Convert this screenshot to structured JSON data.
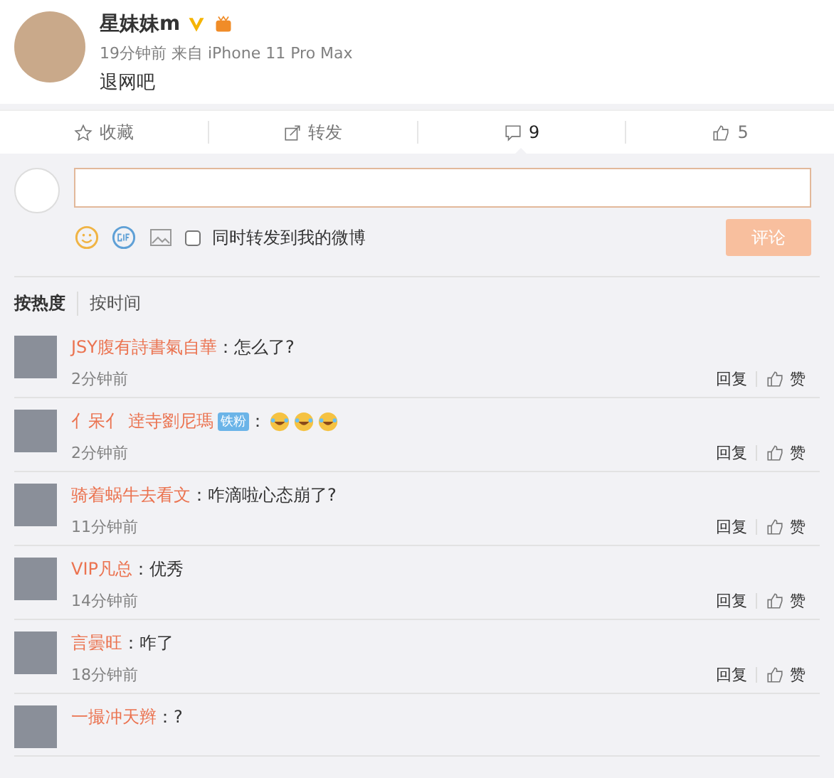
{
  "post": {
    "author": "星妹妹m",
    "verified": true,
    "meta": "19分钟前 来自 iPhone 11 Pro Max",
    "text": "退网吧"
  },
  "actions": [
    {
      "kind": "favorite",
      "label": "收藏",
      "selected": false
    },
    {
      "kind": "repost",
      "label": "转发",
      "selected": false
    },
    {
      "kind": "comment",
      "label": "9",
      "selected": true
    },
    {
      "kind": "like",
      "label": "5",
      "selected": false
    }
  ],
  "composer": {
    "repost_label": "同时转发到我的微博",
    "repost_checked": false,
    "submit": "评论",
    "submit_disabled": true
  },
  "sort_tabs": [
    {
      "label": "按热度",
      "selected": true
    },
    {
      "label": "按时间",
      "selected": false
    }
  ],
  "comments": [
    {
      "name": "JSY腹有詩書氣自華",
      "text": "：怎么了?",
      "time": "2分钟前",
      "reply": "回复",
      "like": "赞"
    },
    {
      "name": "亻呆亻 逹寺劉尼瑪",
      "badge": "铁粉",
      "text": "：",
      "emojis": [
        {
          "kind": "laugh"
        },
        {
          "kind": "laugh"
        },
        {
          "kind": "laugh"
        }
      ],
      "time": "2分钟前",
      "reply": "回复",
      "like": "赞"
    },
    {
      "name": "骑着蜗牛去看文",
      "text": "：咋滴啦心态崩了?",
      "time": "11分钟前",
      "reply": "回复",
      "like": "赞"
    },
    {
      "name": "VIP凡总",
      "text": "：优秀",
      "time": "14分钟前",
      "reply": "回复",
      "like": "赞"
    },
    {
      "name": "言曇旺",
      "text": "：咋了",
      "time": "18分钟前",
      "reply": "回复",
      "like": "赞"
    },
    {
      "name": "一撮冲天辫",
      "text": "：?"
    }
  ]
}
